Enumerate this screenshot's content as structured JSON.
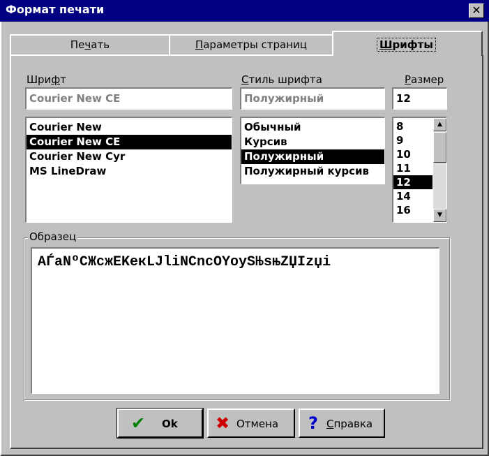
{
  "window": {
    "title": "Формат печати",
    "close_glyph": "✕"
  },
  "tabs": [
    {
      "pre": "Пе",
      "u": "ч",
      "post": "ать"
    },
    {
      "pre": "",
      "u": "П",
      "post": "араметры страниц"
    },
    {
      "pre": "",
      "u": "Ш",
      "post": "рифты"
    }
  ],
  "font": {
    "label": {
      "pre": "Шри",
      "u": "ф",
      "post": "т"
    },
    "value": "Courier New CE",
    "items": [
      "Courier New",
      "Courier New CE",
      "Courier New Cyr",
      "MS LineDraw"
    ],
    "selected_index": 1
  },
  "style": {
    "label": {
      "pre": "",
      "u": "С",
      "post": "тиль шрифта"
    },
    "value": "Полужирный",
    "items": [
      "Обычный",
      "Курсив",
      "Полужирный",
      "Полужирный курсив"
    ],
    "selected_index": 2
  },
  "size": {
    "label": {
      "pre": "",
      "u": "Р",
      "post": "азмер"
    },
    "value": "12",
    "items": [
      "8",
      "9",
      "10",
      "11",
      "12",
      "14",
      "16"
    ],
    "selected_index": 4
  },
  "sample": {
    "label": "Образец",
    "text": "AЃaNºCЖcжEKeкLJliNCncOYoySЊsњZЏIzџi"
  },
  "buttons": {
    "ok": {
      "icon": "checkmark-icon",
      "label": "Ok",
      "color": "#008000"
    },
    "cancel": {
      "icon": "x-icon",
      "label": "Отмена",
      "color": "#cc0000"
    },
    "help": {
      "icon": "question-icon",
      "label_u": "С",
      "label_post": "правка",
      "color": "#0000cc"
    }
  }
}
